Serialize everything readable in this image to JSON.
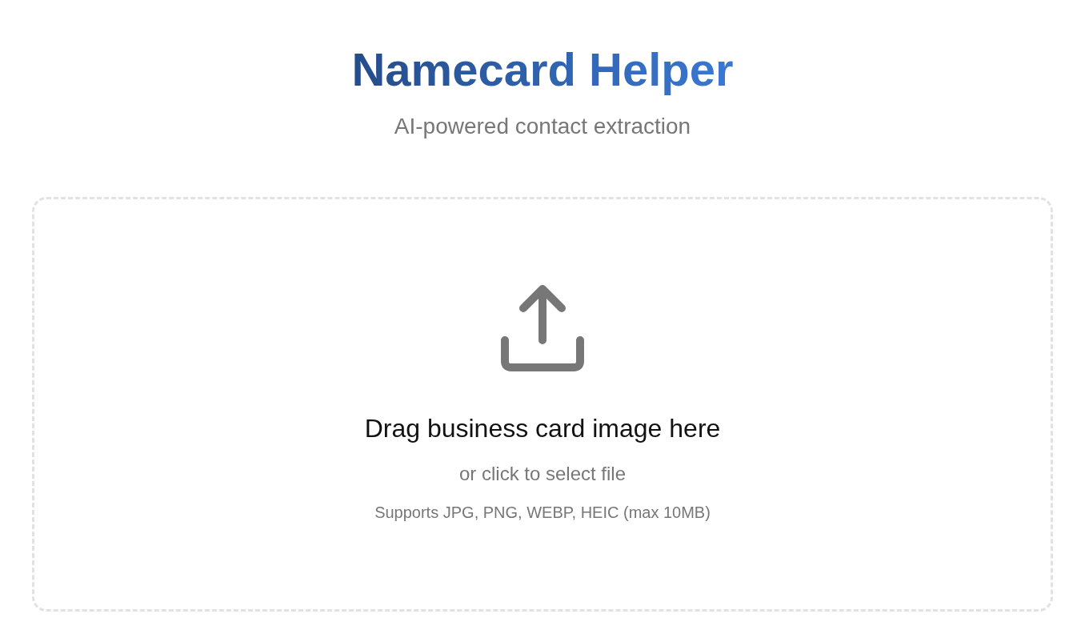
{
  "header": {
    "title": "Namecard Helper",
    "subtitle": "AI-powered contact extraction"
  },
  "dropzone": {
    "heading": "Drag business card image here",
    "action": "or click to select file",
    "hint": "Supports JPG, PNG, WEBP, HEIC (max 10MB)"
  }
}
